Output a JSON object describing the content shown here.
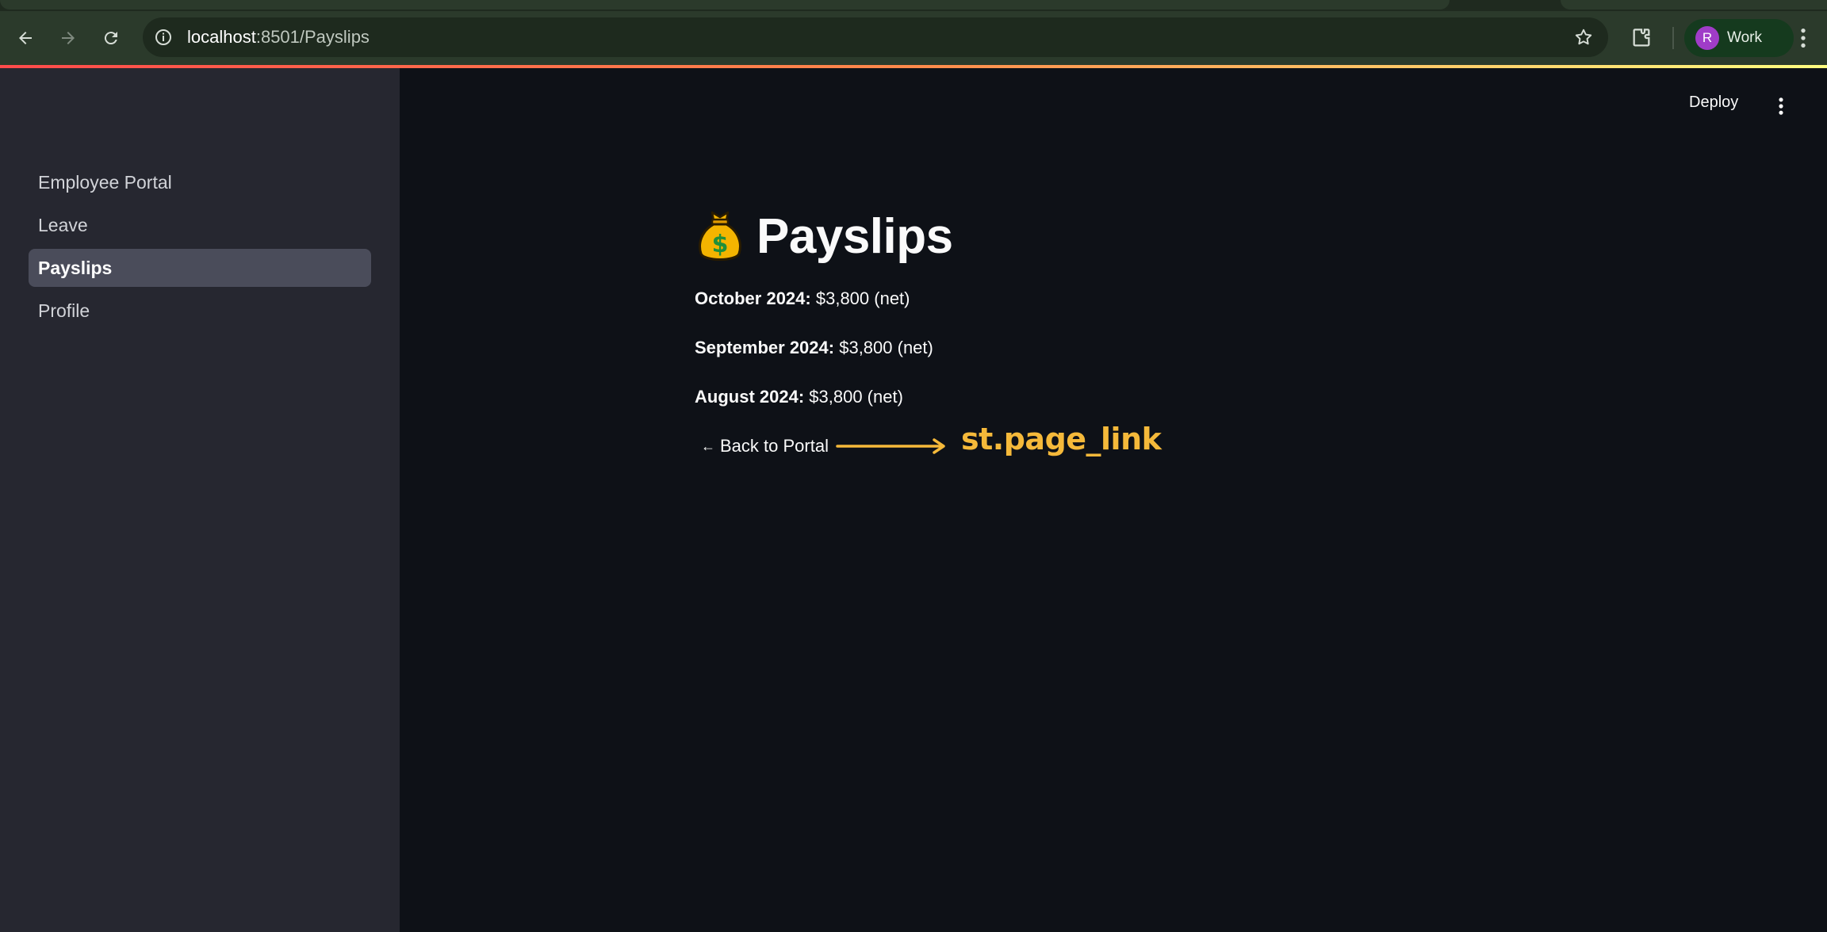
{
  "browser": {
    "url_host": "localhost",
    "url_path": ":8501/Payslips",
    "profile_initial": "R",
    "profile_label": "Work",
    "icons": [
      "back-icon",
      "forward-icon",
      "reload-icon",
      "info-icon",
      "star-icon",
      "extensions-icon",
      "kebab-icon"
    ]
  },
  "app": {
    "deploy_label": "Deploy",
    "accent_colors": [
      "#ff4b4b",
      "#fffd80"
    ]
  },
  "sidebar": {
    "items": [
      {
        "label": "Employee Portal",
        "active": false
      },
      {
        "label": "Leave",
        "active": false
      },
      {
        "label": "Payslips",
        "active": true
      },
      {
        "label": "Profile",
        "active": false
      }
    ]
  },
  "main": {
    "title_icon": "money-bag-icon",
    "title": "Payslips",
    "payslips": [
      {
        "month": "October 2024:",
        "amount": "$3,800 (net)"
      },
      {
        "month": "September 2024:",
        "amount": "$3,800 (net)"
      },
      {
        "month": "August 2024:",
        "amount": "$3,800 (net)"
      }
    ],
    "back_link_arrow": "←",
    "back_link_label": "Back to Portal"
  },
  "annotation": {
    "label": "st.page_link",
    "color": "#f5b93a"
  }
}
